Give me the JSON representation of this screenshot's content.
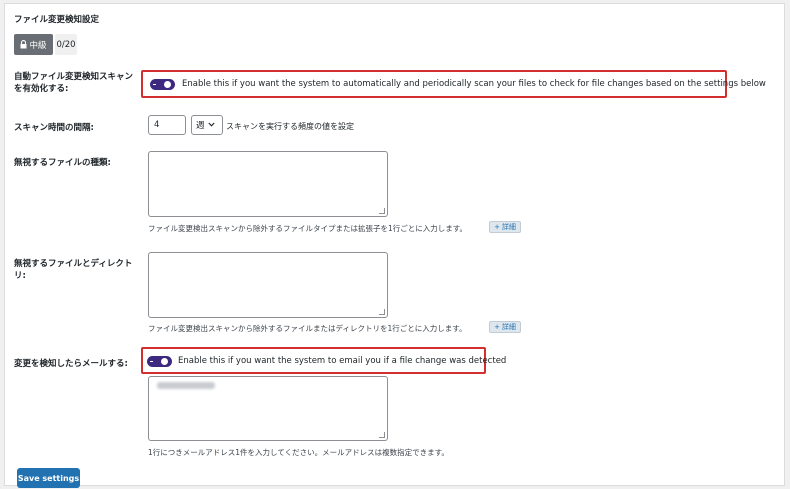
{
  "section_title": "ファイル変更検知設定",
  "level": {
    "label": "中級",
    "count": "0/20"
  },
  "auto_scan": {
    "label_line1": "自動ファイル変更検知スキャン",
    "label_line2": "を有効化する:",
    "toggle_text": "Enable this if you want the system to automatically and periodically scan your files to check for file changes based on the settings below",
    "enabled": true
  },
  "scan_interval": {
    "label": "スキャン時間の間隔:",
    "value": "4",
    "unit_selected": "週",
    "help": "スキャンを実行する頻度の値を設定"
  },
  "ignore_types": {
    "label": "無視するファイルの種類:",
    "value": "",
    "help": "ファイル変更検出スキャンから除外するファイルタイプまたは拡張子を1行ごとに入力します。",
    "detail_label": "詳細"
  },
  "ignore_files": {
    "label_line1": "無視するファイルとディレクト",
    "label_line2": "リ:",
    "value": "",
    "help": "ファイル変更検出スキャンから除外するファイルまたはディレクトリを1行ごとに入力します。",
    "detail_label": "詳細"
  },
  "email_notify": {
    "label": "変更を検知したらメールする:",
    "toggle_text": "Enable this if you want the system to email you if a file change was detected",
    "enabled": true,
    "help": "1行につきメールアドレス1件を入力してください。メールアドレスは複数指定できます。"
  },
  "save_button": "Save settings",
  "colors": {
    "toggle": "#3d2a80",
    "highlight": "#d32f2f",
    "primary": "#2271b1",
    "badge": "#686e73"
  }
}
